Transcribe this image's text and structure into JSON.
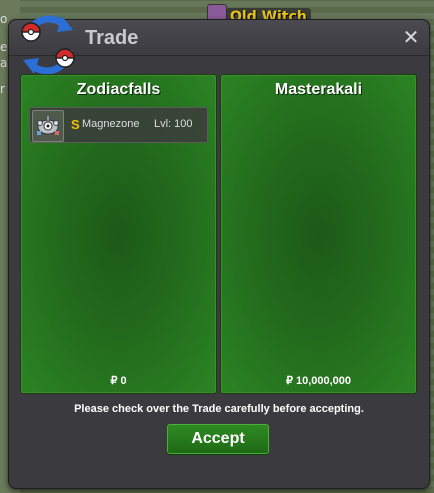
{
  "background": {
    "npc_label": "Old Witch",
    "left_fragments": [
      "o",
      "e",
      "a",
      "r"
    ]
  },
  "window": {
    "title": "Trade",
    "close_symbol": "✕"
  },
  "left_panel": {
    "player_name": "Zodiacfalls",
    "items": [
      {
        "shiny_marker": "S",
        "name": "Magnezone",
        "level": "Lvl: 100",
        "icon": "magnezone-icon"
      }
    ],
    "money_symbol": "₽",
    "money": "0"
  },
  "right_panel": {
    "player_name": "Masterakali",
    "money_symbol": "₽",
    "money": "10,000,000"
  },
  "footer": {
    "message": "Please check over the Trade carefully before accepting.",
    "accept_label": "Accept"
  },
  "colors": {
    "panel_green": "#226a1c",
    "accept_green": "#2f8a22",
    "shiny_gold": "#f0c000"
  }
}
